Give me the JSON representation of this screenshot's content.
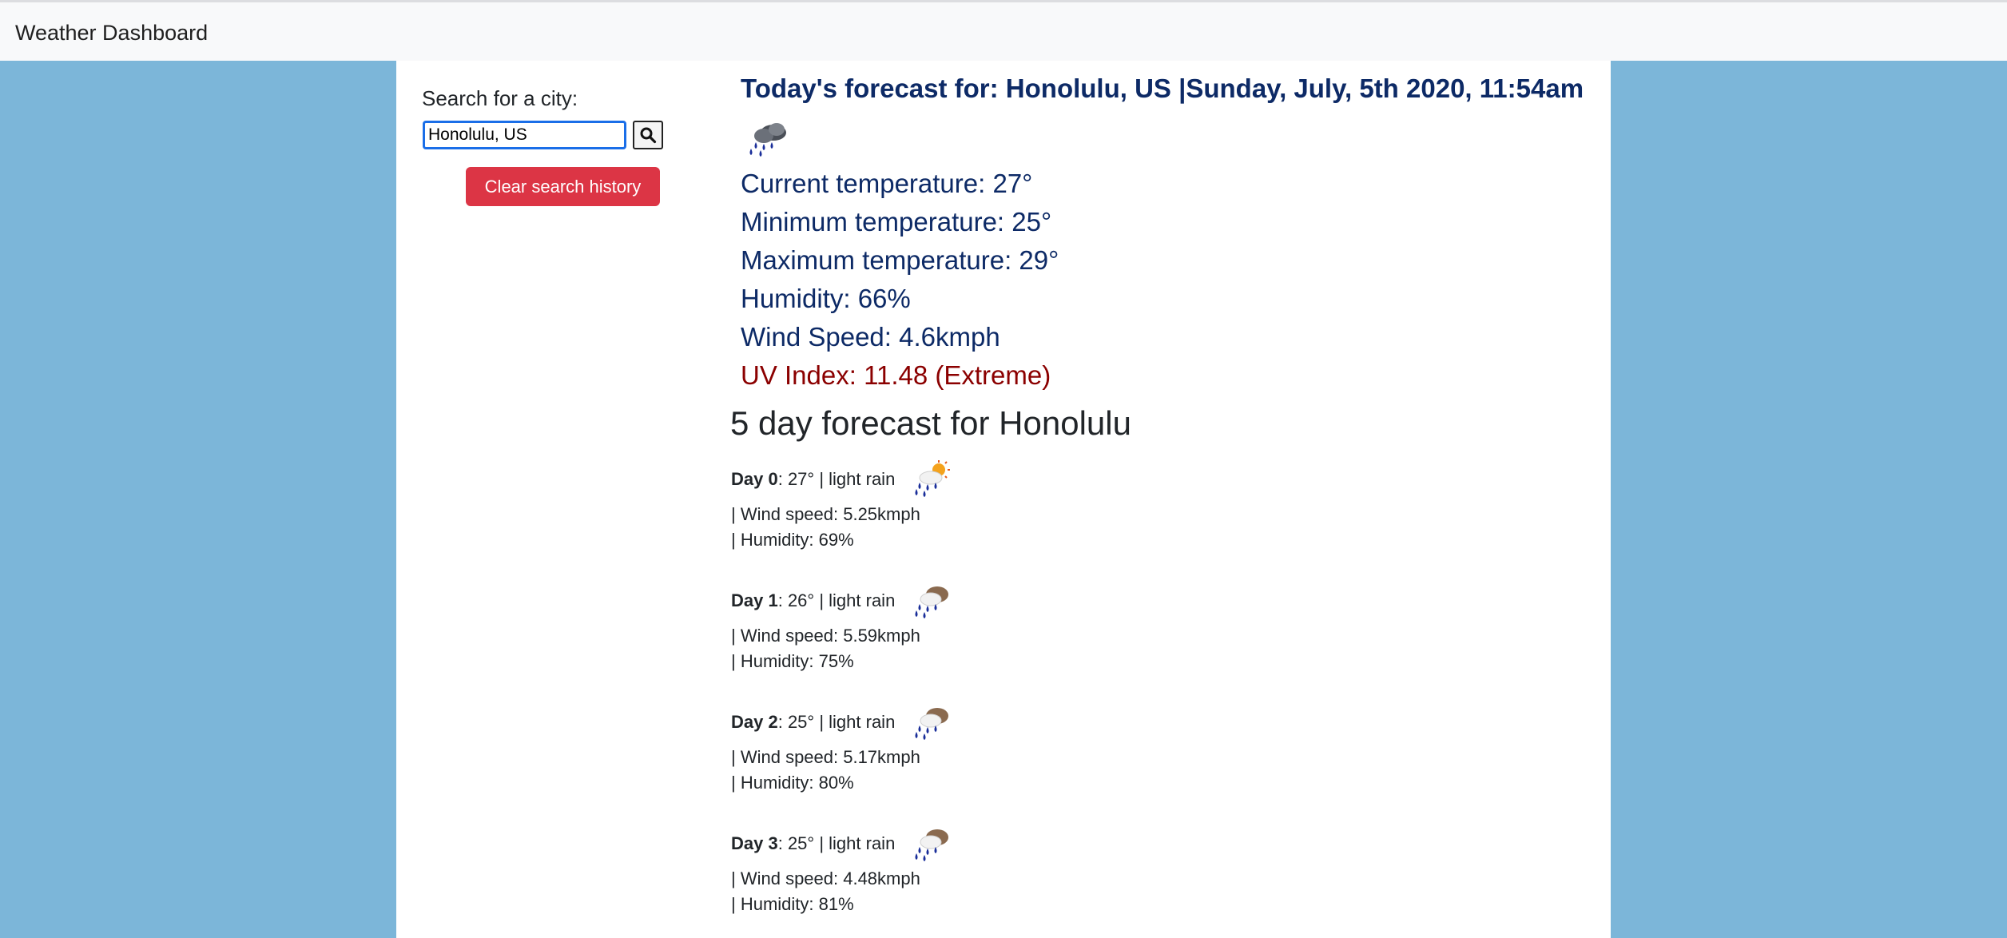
{
  "app": {
    "title": "Weather Dashboard"
  },
  "search": {
    "label": "Search for a city:",
    "value": "Honolulu, US",
    "button_icon": "search-icon",
    "clear_label": "Clear search history"
  },
  "current": {
    "title": "Today's forecast for: Honolulu, US |Sunday, July, 5th 2020, 11:54am",
    "icon": "light-rain-icon",
    "temperature": "Current temperature: 27°",
    "min_temp": "Minimum temperature: 25°",
    "max_temp": "Maximum temperature: 29°",
    "humidity": "Humidity: 66%",
    "wind": "Wind Speed: 4.6kmph",
    "uv": "UV Index: 11.48 (Extreme)"
  },
  "forecast": {
    "heading": "5 day forecast for Honolulu",
    "days": [
      {
        "label": "Day 0",
        "summary": ": 27° | light rain",
        "wind": "| Wind speed: 5.25kmph",
        "humidity": "| Humidity: 69%",
        "icon": "light-rain-day-icon"
      },
      {
        "label": "Day 1",
        "summary": ": 26° | light rain",
        "wind": "| Wind speed: 5.59kmph",
        "humidity": "| Humidity: 75%",
        "icon": "light-rain-night-icon"
      },
      {
        "label": "Day 2",
        "summary": ": 25° | light rain",
        "wind": "| Wind speed: 5.17kmph",
        "humidity": "| Humidity: 80%",
        "icon": "light-rain-night-icon"
      },
      {
        "label": "Day 3",
        "summary": ": 25° | light rain",
        "wind": "| Wind speed: 4.48kmph",
        "humidity": "| Humidity: 81%",
        "icon": "light-rain-night-icon"
      }
    ]
  },
  "colors": {
    "background": "#7cb6d9",
    "navbar": "#f8f9fa",
    "panel": "#ffffff",
    "title_text": "#0d2a66",
    "uv_extreme": "#8b0000",
    "danger_button": "#dc3545",
    "input_focus": "#1a6ee8"
  }
}
